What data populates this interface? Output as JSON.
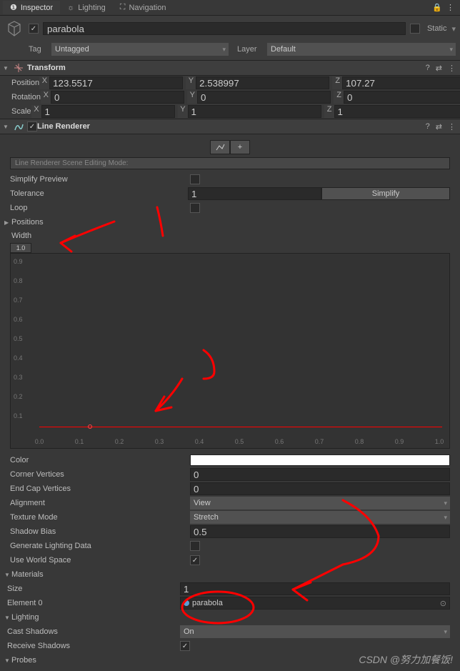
{
  "tabs": {
    "inspector": "Inspector",
    "lighting": "Lighting",
    "navigation": "Navigation"
  },
  "header": {
    "name": "parabola",
    "static": "Static"
  },
  "tagLayer": {
    "tagLabel": "Tag",
    "tag": "Untagged",
    "layerLabel": "Layer",
    "layer": "Default"
  },
  "transform": {
    "title": "Transform",
    "position": {
      "label": "Position",
      "x": "123.5517",
      "y": "2.538997",
      "z": "107.27"
    },
    "rotation": {
      "label": "Rotation",
      "x": "0",
      "y": "0",
      "z": "0"
    },
    "scale": {
      "label": "Scale",
      "x": "1",
      "y": "1",
      "z": "1"
    }
  },
  "lineRenderer": {
    "title": "Line Renderer",
    "sceneModeLabel": "Line Renderer Scene Editing Mode:",
    "simplifyPreview": "Simplify Preview",
    "tolerance": "Tolerance",
    "toleranceValue": "1",
    "simplifyBtn": "Simplify",
    "loop": "Loop",
    "positions": "Positions",
    "width": "Width",
    "widthBadge": "1.0",
    "yTicks": [
      "0.9",
      "0.8",
      "0.7",
      "0.6",
      "0.5",
      "0.4",
      "0.3",
      "0.2",
      "0.1"
    ],
    "xTicks": [
      "0.0",
      "0.1",
      "0.2",
      "0.3",
      "0.4",
      "0.5",
      "0.6",
      "0.7",
      "0.8",
      "0.9",
      "1.0"
    ],
    "color": "Color",
    "cornerVertices": "Corner Vertices",
    "cornerVerticesValue": "0",
    "endCapVertices": "End Cap Vertices",
    "endCapVerticesValue": "0",
    "alignment": "Alignment",
    "alignmentValue": "View",
    "textureMode": "Texture Mode",
    "textureModeValue": "Stretch",
    "shadowBias": "Shadow Bias",
    "shadowBiasValue": "0.5",
    "generateLightingData": "Generate Lighting Data",
    "useWorldSpace": "Use World Space",
    "materials": "Materials",
    "size": "Size",
    "sizeValue": "1",
    "element0": "Element 0",
    "element0Value": "parabola",
    "lighting": "Lighting",
    "castShadows": "Cast Shadows",
    "castShadowsValue": "On",
    "receiveShadows": "Receive Shadows",
    "probes": "Probes"
  },
  "watermark": "CSDN @努力加餐饭!"
}
